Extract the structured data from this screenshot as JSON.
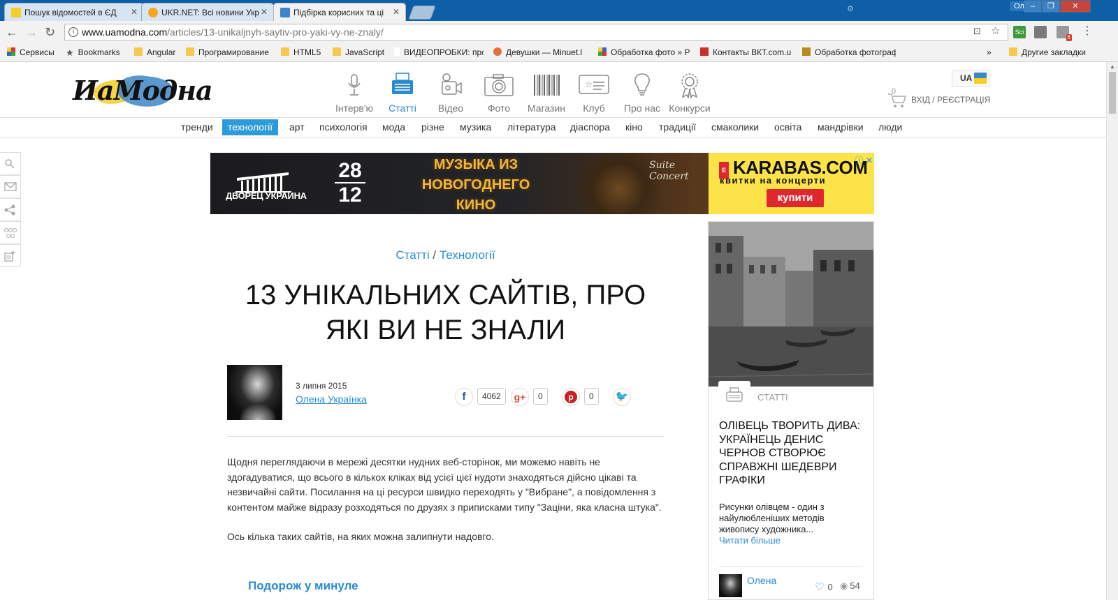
{
  "browser": {
    "tabs": [
      {
        "title": "Пошук відомостей в ЄД",
        "favicon_color": "#f5cd24"
      },
      {
        "title": "UKR.NET: Всі новини Укр",
        "favicon_color": "#f5a623"
      },
      {
        "title": "Підбірка корисних та ці",
        "favicon_color": "#3f86c8"
      }
    ],
    "window_user": "Олег",
    "window_buttons": {
      "minimize": "‒",
      "maximize": "❐",
      "close": "✕"
    },
    "url_host": "www.uamodna.com",
    "url_path": "/articles/13-unikaljnyh-saytiv-pro-yaki-vy-ne-znaly/",
    "extensions": [
      {
        "label": "Sci",
        "color": "#3f9a3a"
      },
      {
        "label": "",
        "color": "#7a7a7a"
      },
      {
        "label": "6",
        "color": "#d23b30"
      }
    ],
    "bookmarks": [
      {
        "label": "Сервисы",
        "icon": "apps-icon"
      },
      {
        "label": "Bookmarks",
        "icon": "star-icon"
      },
      {
        "label": "Angular",
        "icon": "folder-icon"
      },
      {
        "label": "Програмирование",
        "icon": "folder-icon"
      },
      {
        "label": "HTML5",
        "icon": "folder-icon"
      },
      {
        "label": "JavaScript",
        "icon": "folder-icon"
      },
      {
        "label": "ВИДЕОПРОБКИ: про",
        "icon": "video-icon"
      },
      {
        "label": "Девушки — Minuet.l",
        "icon": "site-icon"
      },
      {
        "label": "Обработка фото » Р",
        "icon": "site-icon"
      },
      {
        "label": "Контакты ВКТ.com.u",
        "icon": "site-icon"
      },
      {
        "label": "Обработка фотограф",
        "icon": "site-icon"
      }
    ],
    "bookmarks_overflow": "»",
    "other_bookmarks": "Другие закладки"
  },
  "site": {
    "logo_text": "UaModna",
    "menu": [
      {
        "label": "Інтерв'ю",
        "icon": "microphone-icon",
        "active": false
      },
      {
        "label": "Статті",
        "icon": "typewriter-icon",
        "active": true
      },
      {
        "label": "Відео",
        "icon": "video-camera-icon",
        "active": false
      },
      {
        "label": "Фото",
        "icon": "camera-icon",
        "active": false
      },
      {
        "label": "Магазин",
        "icon": "barcode-icon",
        "active": false
      },
      {
        "label": "Клуб",
        "icon": "club-card-icon",
        "active": false
      },
      {
        "label": "Про нас",
        "icon": "lightbulb-icon",
        "active": false
      },
      {
        "label": "Конкурси",
        "icon": "award-icon",
        "active": false
      }
    ],
    "lang": "UA",
    "cart_count": "0",
    "login": "ВХІД / РЕЄСТРАЦІЯ",
    "categories": [
      "тренди",
      "технології",
      "арт",
      "психологія",
      "мода",
      "різне",
      "музика",
      "література",
      "діаспора",
      "кіно",
      "традиції",
      "смаколики",
      "освіта",
      "мандрівки",
      "люди"
    ],
    "active_category": "технології",
    "colors": {
      "accent": "#2a8ad2",
      "category_active_bg": "#2d9ad9",
      "flag_blue": "#3f86c8",
      "flag_yellow": "#f5cd24"
    }
  },
  "banner": {
    "venue": "ДВОРЕЦ УКРАИНА",
    "date_day": "28",
    "date_month": "12",
    "title": "МУЗЫКА ИЗ НОВОГОДНЕГО КИНО",
    "script": "Suite Concert",
    "karabas_logo": "KARABAS.COM",
    "karabas_sub": "квитки на концерти",
    "karabas_button": "купити",
    "ad_marker": "ⓘ ✕"
  },
  "article": {
    "crumb_section": "Статті",
    "crumb_sep": "/",
    "crumb_category": "Технології",
    "title": "13 УНІКАЛЬНИХ САЙТІВ, ПРО ЯКІ ВИ НЕ ЗНАЛИ",
    "date": "3 липня 2015",
    "author": "Олена Українка",
    "shares": {
      "facebook": "4062",
      "googleplus": "0",
      "pinterest": "0"
    },
    "paragraph1": "Щодня переглядаючи в мережі десятки нудних веб-сторінок, ми можемо навіть не здогадуватися, що всього в кількох кліках від усієї цієї нудоти знаходяться дійсно цікаві та незвичайні сайти. Посилання на ці ресурси швидко переходять у \"Вибране\", а повідомлення з контентом майже відразу розходяться по друзях з приписками типу \"Заціни, яка класна штука\".",
    "paragraph2": "Ось кілька таких сайтів, на яких можна залипнути надовго.",
    "subhead": "Подорож у минуле"
  },
  "sidebar_card": {
    "category": "СТАТТІ",
    "title": "ОЛІВЕЦЬ ТВОРИТЬ ДИВА: УКРАЇНЕЦЬ ДЕНИС ЧЕРНОВ СТВОРЮЄ СПРАВЖНІ ШЕДЕВРИ ГРАФІКИ",
    "excerpt": "Рисунки олівцем - один з найулюбленіших методів живопису художника...",
    "read_more": "Читати більше",
    "author": "Олена",
    "likes": "0",
    "views": "54"
  }
}
